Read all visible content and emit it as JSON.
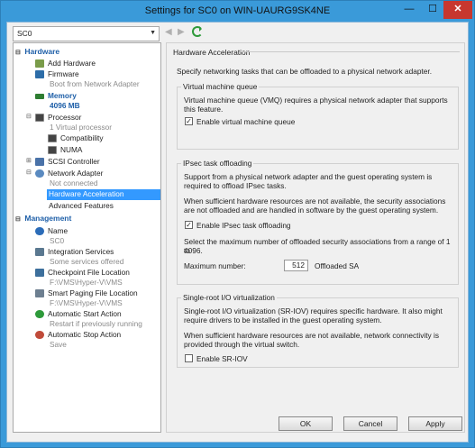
{
  "window": {
    "title": "Settings for SC0 on WIN-UAURG9SK4NE",
    "minimize_glyph": "—",
    "maximize_glyph": "☐",
    "close_glyph": "✕"
  },
  "vm_selector": {
    "value": "SC0"
  },
  "tree": {
    "hardware_header": "Hardware",
    "add_hardware": "Add Hardware",
    "firmware": "Firmware",
    "firmware_sub": "Boot from Network Adapter",
    "memory": "Memory",
    "memory_sub": "4096 MB",
    "processor": "Processor",
    "processor_sub": "1 Virtual processor",
    "compatibility": "Compatibility",
    "numa": "NUMA",
    "scsi": "SCSI Controller",
    "network_adapter": "Network Adapter",
    "network_sub": "Not connected",
    "hw_accel": "Hardware Acceleration",
    "adv_features": "Advanced Features",
    "management_header": "Management",
    "name": "Name",
    "name_sub": "SC0",
    "integration": "Integration Services",
    "integration_sub": "Some services offered",
    "checkpoint": "Checkpoint File Location",
    "checkpoint_sub": "F:\\VMS\\Hyper-V\\VMS",
    "paging": "Smart Paging File Location",
    "paging_sub": "F:\\VMS\\Hyper-V\\VMS",
    "auto_start": "Automatic Start Action",
    "auto_start_sub": "Restart if previously running",
    "auto_stop": "Automatic Stop Action",
    "auto_stop_sub": "Save"
  },
  "panel": {
    "title": "Hardware Acceleration",
    "description": "Specify networking tasks that can be offloaded to a physical network adapter.",
    "vmq": {
      "legend": "Virtual machine queue",
      "text1": "Virtual machine queue (VMQ) requires a physical network adapter that supports",
      "text2": "this feature.",
      "checkbox_label": "Enable virtual machine queue",
      "checked": true
    },
    "ipsec": {
      "legend": "IPsec task offloading",
      "text1": "Support from a physical network adapter and the guest operating system is",
      "text2": "required to offload IPsec tasks.",
      "text3": "When sufficient hardware resources are not available, the security associations",
      "text4": "are not offloaded and are handled in software by the guest operating system.",
      "checkbox_label": "Enable IPsec task offloading",
      "checked": true,
      "range1": "Select the maximum number of offloaded security associations from a range of 1 to",
      "range2": "4096.",
      "max_label": "Maximum number:",
      "max_value": "512",
      "unit": "Offloaded SA"
    },
    "sriov": {
      "legend": "Single-root I/O virtualization",
      "text1": "Single-root I/O virtualization (SR-IOV) requires specific hardware. It also might",
      "text2": "require drivers to be installed in the guest operating system.",
      "text3": "When sufficient hardware resources are not available, network connectivity is",
      "text4": "provided through the virtual switch.",
      "checkbox_label": "Enable SR-IOV",
      "checked": false
    }
  },
  "buttons": {
    "ok": "OK",
    "cancel": "Cancel",
    "apply": "Apply"
  },
  "colors": {
    "titlebar": "#3a9ad9",
    "selection": "#3399ff",
    "section": "#1e5fa8",
    "close": "#c7372f"
  }
}
